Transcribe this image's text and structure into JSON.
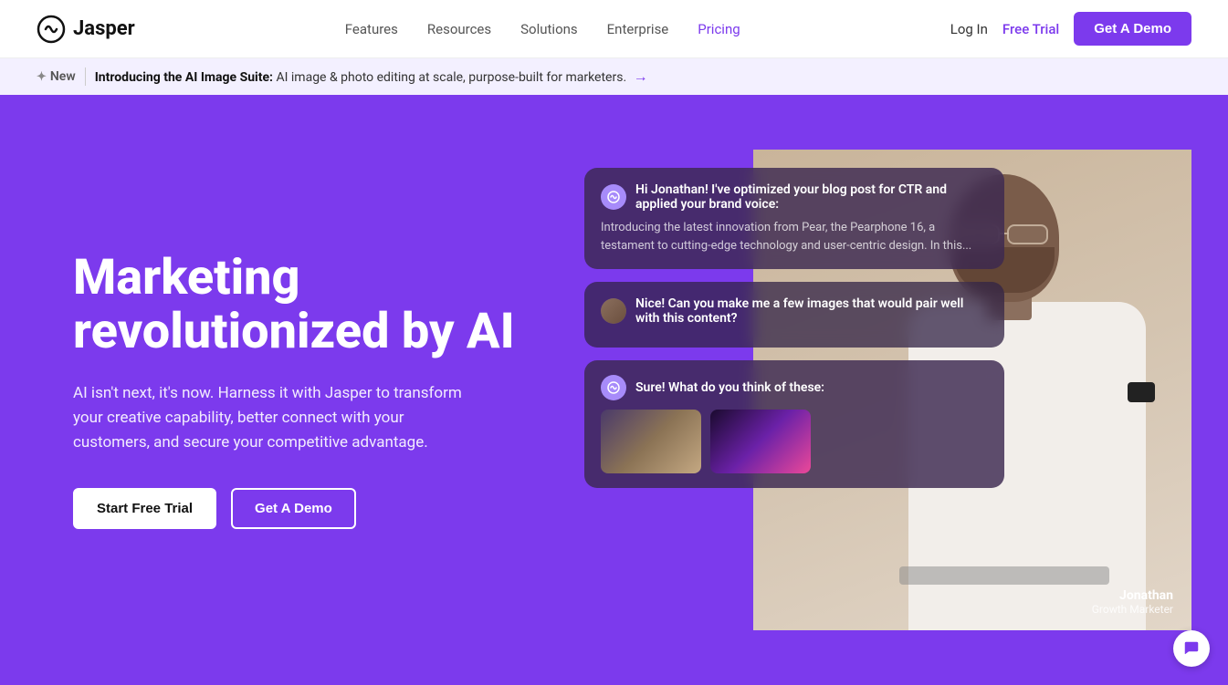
{
  "logo": {
    "text": "Jasper"
  },
  "nav": {
    "links": [
      {
        "label": "Features",
        "id": "features",
        "color": "normal"
      },
      {
        "label": "Resources",
        "id": "resources",
        "color": "normal"
      },
      {
        "label": "Solutions",
        "id": "solutions",
        "color": "normal"
      },
      {
        "label": "Enterprise",
        "id": "enterprise",
        "color": "normal"
      },
      {
        "label": "Pricing",
        "id": "pricing",
        "color": "purple"
      }
    ],
    "login_label": "Log In",
    "free_trial_label": "Free Trial",
    "demo_btn_label": "Get A Demo"
  },
  "announcement": {
    "new_label": "New",
    "title": "Introducing the AI Image Suite:",
    "body": "AI image & photo editing at scale, purpose-built for marketers.",
    "arrow": "→"
  },
  "hero": {
    "title": "Marketing revolutionized by AI",
    "subtitle": "AI isn't next, it's now. Harness it with Jasper to transform your creative capability, better connect with your customers, and secure your competitive advantage.",
    "btn_trial": "Start Free Trial",
    "btn_demo": "Get A Demo"
  },
  "chat": {
    "bubble1": {
      "header": "Hi Jonathan! I've optimized your blog post for CTR and applied your brand voice:",
      "body": "Introducing the latest innovation from Pear, the Pearphone 16, a testament to cutting-edge technology and user-centric design. In this..."
    },
    "bubble2": {
      "body": "Nice! Can you make me a few images that would pair well with this content?"
    },
    "bubble3": {
      "header": "Sure! What do you think of these:"
    }
  },
  "person": {
    "name": "Jonathan",
    "role": "Growth Marketer"
  },
  "colors": {
    "brand_purple": "#7c3aed",
    "hero_bg": "#7c3aed",
    "announcement_bg": "#f3f0ff"
  }
}
